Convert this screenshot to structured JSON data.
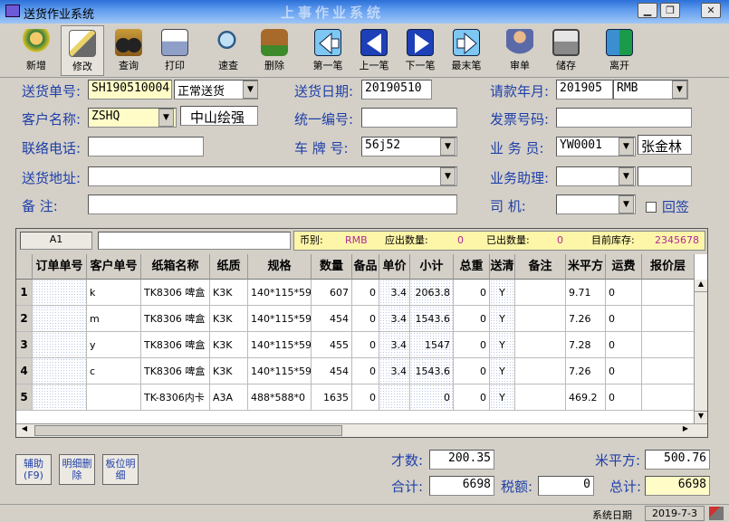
{
  "window": {
    "title": "送货作业系统",
    "watermark": "上事作业系统"
  },
  "toolbar": [
    {
      "label": "新增",
      "icon": "add-person-icon"
    },
    {
      "label": "修改",
      "icon": "edit-icon"
    },
    {
      "label": "查询",
      "icon": "binoculars-icon"
    },
    {
      "label": "打印",
      "icon": "printer-icon"
    },
    {
      "label": "速查",
      "icon": "magnifier-icon"
    },
    {
      "label": "删除",
      "icon": "dump-sign-icon"
    },
    {
      "label": "第一笔",
      "icon": "first-arrow-icon"
    },
    {
      "label": "上一笔",
      "icon": "prev-arrow-icon"
    },
    {
      "label": "下一笔",
      "icon": "next-arrow-icon"
    },
    {
      "label": "最末笔",
      "icon": "last-arrow-icon"
    },
    {
      "label": "审单",
      "icon": "audit-icon"
    },
    {
      "label": "储存",
      "icon": "floppy-icon"
    },
    {
      "label": "离开",
      "icon": "exit-door-icon"
    }
  ],
  "form": {
    "order_no_label": "送货单号:",
    "order_no": "SH190510004",
    "delivery_type": "正常送货",
    "date_label": "送货日期:",
    "date": "20190510",
    "bill_month_label": "请款年月:",
    "bill_month": "201905",
    "currency": "RMB",
    "customer_label": "客户名称:",
    "customer_code": "ZSHQ",
    "customer_name": "中山绘强",
    "unified_no_label": "统一编号:",
    "unified_no": "",
    "invoice_label": "发票号码:",
    "invoice": "",
    "phone_label": "联络电话:",
    "phone": "",
    "plate_label": "车 牌 号:",
    "plate": "56j52",
    "salesman_label": "业 务 员:",
    "salesman_code": "YW0001",
    "salesman_name": "张金林",
    "address_label": "送货地址:",
    "address": "",
    "assistant_label": "业务助理:",
    "assistant": "",
    "note_label": "备    注:",
    "note": "",
    "driver_label": "司    机:",
    "driver": "",
    "return_label": "回签"
  },
  "grid": {
    "cell_ref": "A1",
    "info": {
      "currency_label": "币别:",
      "currency": "RMB",
      "should_qty_label": "应出数量:",
      "should_qty": "0",
      "shipped_label": "已出数量:",
      "shipped": "0",
      "stock_label": "目前库存:",
      "stock": "2345678"
    },
    "headers": [
      "",
      "订单单号",
      "客户单号",
      "纸箱名称",
      "纸质",
      "规格",
      "数量",
      "备品",
      "单价",
      "小计",
      "总重",
      "送清",
      "备注",
      "米平方",
      "运费",
      "报价层"
    ],
    "rows": [
      [
        "1",
        "",
        "k",
        "TK8306 啤盒",
        "K3K",
        "140*115*59",
        "607",
        "0",
        "3.4",
        "2063.8",
        "0",
        "Y",
        "",
        "9.71",
        "0",
        ""
      ],
      [
        "2",
        "",
        "m",
        "TK8306 啤盒",
        "K3K",
        "140*115*59",
        "454",
        "0",
        "3.4",
        "1543.6",
        "0",
        "Y",
        "",
        "7.26",
        "0",
        ""
      ],
      [
        "3",
        "",
        "y",
        "TK8306 啤盒",
        "K3K",
        "140*115*59",
        "455",
        "0",
        "3.4",
        "1547",
        "0",
        "Y",
        "",
        "7.28",
        "0",
        ""
      ],
      [
        "4",
        "",
        "c",
        "TK8306 啤盒",
        "K3K",
        "140*115*59",
        "454",
        "0",
        "3.4",
        "1543.6",
        "0",
        "Y",
        "",
        "7.26",
        "0",
        ""
      ],
      [
        "5",
        "",
        "",
        "TK-8306内卡",
        "A3A",
        "488*588*0",
        "1635",
        "0",
        "",
        "0",
        "0",
        "Y",
        "",
        "469.2",
        "0",
        ""
      ]
    ]
  },
  "side_buttons": [
    "辅助(F9)",
    "明细删除",
    "板位明细"
  ],
  "totals": {
    "cai_label": "才数:",
    "cai": "200.35",
    "sqm_label": "米平方:",
    "sqm": "500.76",
    "sum_label": "合计:",
    "sum": "6698",
    "tax_label": "税额:",
    "tax": "0",
    "total_label": "总计:",
    "total": "6698"
  },
  "status": {
    "label": "系统日期",
    "date": "2019-7-3"
  }
}
